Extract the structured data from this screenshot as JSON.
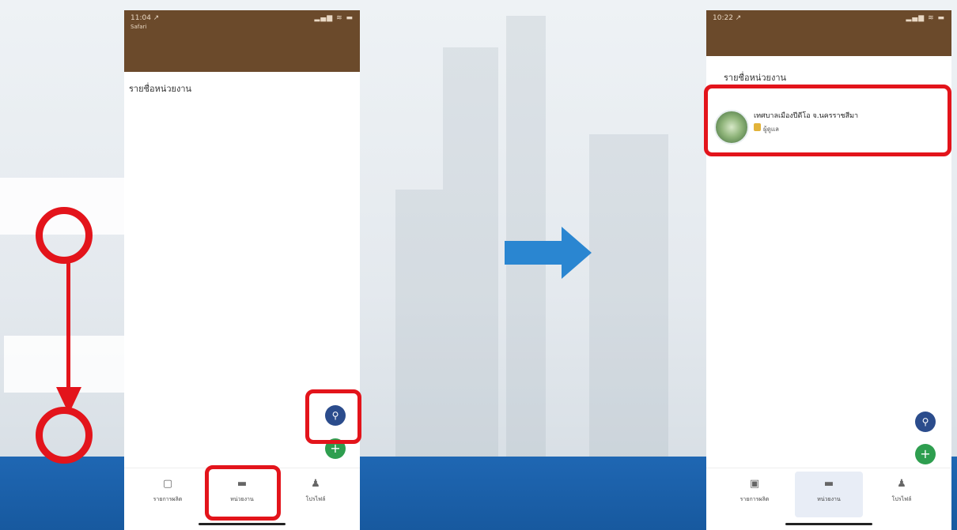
{
  "left_phone": {
    "status": {
      "time": "11:04 ↗",
      "carrier": "Safari",
      "icons": "▂▄▆ ≋ ▬"
    },
    "section_title": "รายชื่อหน่วยงาน",
    "nav": [
      {
        "icon": "calendar-icon",
        "glyph": "▢",
        "label": "รายการผลิต"
      },
      {
        "icon": "folder-icon",
        "glyph": "▬",
        "label": "หน่วยงาน"
      },
      {
        "icon": "user-icon",
        "glyph": "♟",
        "label": "โปรไฟล์"
      }
    ]
  },
  "right_phone": {
    "status": {
      "time": "10:22 ↗",
      "icons": "▂▄▆ ≋ ▬"
    },
    "section_title": "รายชื่อหน่วยงาน",
    "agency": {
      "name": "เทศบาลเมืองปีดีโอ จ.นครราชสีมา",
      "role": "ผู้ดูแล"
    },
    "nav": [
      {
        "icon": "calendar-icon",
        "glyph": "▣",
        "label": "รายการผลิต"
      },
      {
        "icon": "folder-icon",
        "glyph": "▬",
        "label": "หน่วยงาน"
      },
      {
        "icon": "user-icon",
        "glyph": "♟",
        "label": "โปรไฟล์"
      }
    ]
  },
  "fab": {
    "search_glyph": "⚲",
    "add_glyph": "+"
  },
  "colors": {
    "accent_red": "#e3141b",
    "header_brown": "#6b4a2b",
    "flow_arrow": "#2a86d1",
    "band_blue": "#1f67b3"
  }
}
